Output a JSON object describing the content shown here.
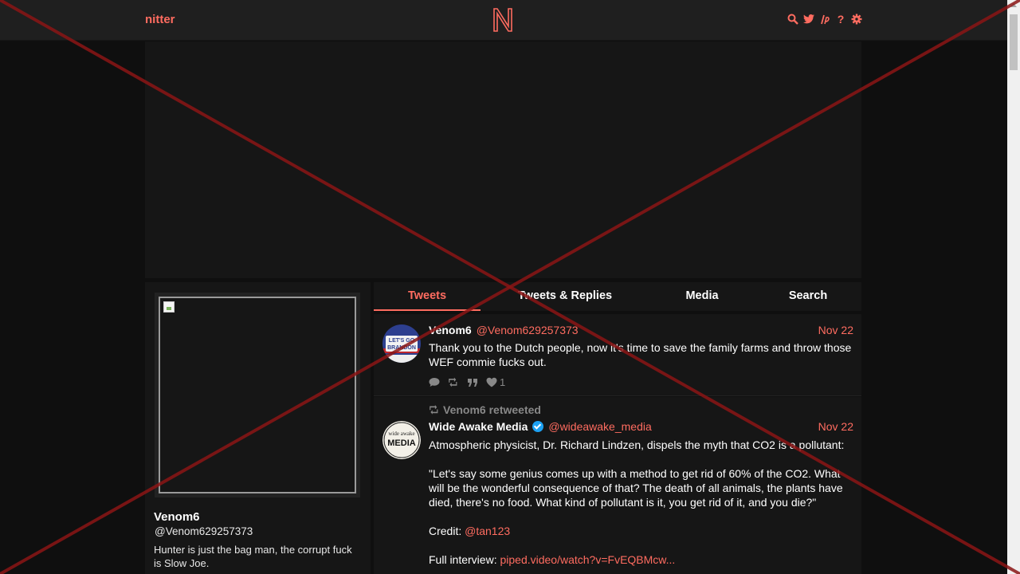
{
  "nav": {
    "brand": "nitter",
    "logo": "N",
    "icons": [
      "search-icon",
      "twitter-bird-icon",
      "rss-icon",
      "help-icon",
      "settings-gear-icon"
    ],
    "help_glyph": "?"
  },
  "colors": {
    "accent": "#ff6c60",
    "background": "#0f0f0f",
    "panel": "#161616",
    "overlay_red": "#8b1515"
  },
  "profile": {
    "name": "Venom6",
    "handle": "@Venom629257373",
    "bio": "Hunter is just the bag man, the corrupt fuck is Slow Joe."
  },
  "tabs": [
    "Tweets",
    "Tweets & Replies",
    "Media",
    "Search"
  ],
  "tweets": [
    {
      "name": "Venom6",
      "handle": "@Venom629257373",
      "date": "Nov 22",
      "avatar_text_1": "LET'S GO",
      "avatar_text_2": "BRANDON",
      "text": "Thank you to the Dutch people, now it's time to save the family farms and throw those WEF commie fucks out.",
      "likes": "1"
    },
    {
      "retweet_label": "Venom6 retweeted",
      "name": "Wide Awake Media",
      "handle": "@wideawake_media",
      "date": "Nov 22",
      "avatar_text_1": "wide awake",
      "avatar_text_2": "MEDIA",
      "para1": "Atmospheric physicist, Dr. Richard Lindzen, dispels the myth that CO2 is a pollutant:",
      "para2": "\"Let's say some genius comes up with a method to get rid of 60% of the CO2. What will be the wonderful consequence of that? The death of all animals, the plants have died, there's no food. What kind of pollutant is it, you get rid of it, and you die?\"",
      "credit_label": "Credit:",
      "credit_link": "@tan123",
      "interview_label": "Full interview:",
      "interview_link": "piped.video/watch?v=FvEQBMcw..."
    }
  ]
}
